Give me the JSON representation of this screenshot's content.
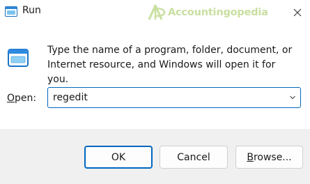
{
  "window": {
    "title": "Run",
    "watermark": "Accountingopedia"
  },
  "dialog": {
    "description": "Type the name of a program, folder, document, or Internet resource, and Windows will open it for you.",
    "open_label_mnemonic": "O",
    "open_label_rest": "pen:",
    "open_value": "regedit"
  },
  "buttons": {
    "ok": "OK",
    "cancel": "Cancel",
    "browse_mnemonic": "B",
    "browse_rest": "rowse..."
  },
  "colors": {
    "accent": "#0067c0",
    "footer_bg": "#f0f0f0",
    "watermark": "#c9dfa0"
  },
  "icons": {
    "app": "run-app-icon",
    "close": "close-icon",
    "dropdown": "chevron-down-icon"
  }
}
